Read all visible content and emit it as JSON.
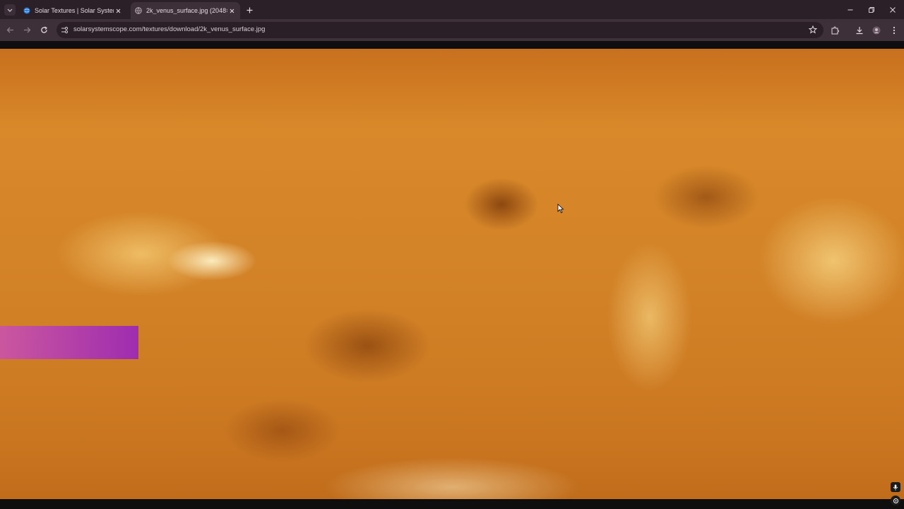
{
  "tabs": [
    {
      "title": "Solar Textures | Solar System Sc",
      "favicon": "globe-icon",
      "active": false
    },
    {
      "title": "2k_venus_surface.jpg (2048×10",
      "favicon": "globe-icon",
      "active": true
    }
  ],
  "address_bar": {
    "url": "solarsystemscope.com/textures/download/2k_venus_surface.jpg"
  },
  "colors": {
    "titlebar": "#2b1f28",
    "toolbar": "#3e3039",
    "highlight": "#b040d0"
  },
  "icons": [
    "tab-search-icon",
    "new-tab-icon",
    "minimize-icon",
    "restore-icon",
    "close-window-icon",
    "back-icon",
    "forward-icon",
    "reload-icon",
    "site-info-icon",
    "bookmark-star-icon",
    "extensions-icon",
    "download-icon",
    "profile-icon",
    "menu-icon",
    "mouse-cursor-icon",
    "mic-icon",
    "lens-icon"
  ]
}
